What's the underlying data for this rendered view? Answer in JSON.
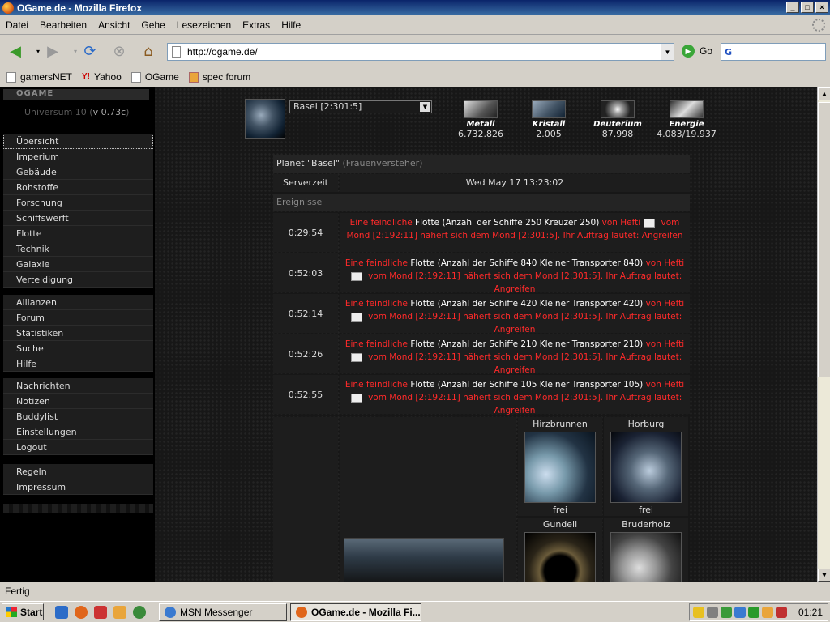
{
  "window": {
    "title": "OGame.de - Mozilla Firefox"
  },
  "menubar": {
    "items": [
      "Datei",
      "Bearbeiten",
      "Ansicht",
      "Gehe",
      "Lesezeichen",
      "Extras",
      "Hilfe"
    ]
  },
  "navbar": {
    "url": "http://ogame.de/",
    "go_label": "Go",
    "search_brand": "G"
  },
  "bookmarks": [
    {
      "label": "gamersNET",
      "icon": "page-icon"
    },
    {
      "label": "Yahoo",
      "icon": "yahoo-icon"
    },
    {
      "label": "OGame",
      "icon": "page-icon"
    },
    {
      "label": "spec forum",
      "icon": "bookmark-folder-icon"
    }
  ],
  "game": {
    "logo": "OGAME",
    "universe": "Universum 10",
    "version": "v 0.73c",
    "menu_groups": [
      [
        "Übersicht",
        "Imperium",
        "Gebäude",
        "Rohstoffe",
        "Forschung",
        "Schiffswerft",
        "Flotte",
        "Technik",
        "Galaxie",
        "Verteidigung"
      ],
      [
        "Allianzen",
        "Forum",
        "Statistiken",
        "Suche",
        "Hilfe"
      ],
      [
        "Nachrichten",
        "Notizen",
        "Buddylist",
        "Einstellungen",
        "Logout"
      ],
      [
        "Regeln",
        "Impressum"
      ]
    ],
    "planet_select": "Basel [2:301:5]",
    "resources": [
      {
        "name": "Metall",
        "value": "6.732.826"
      },
      {
        "name": "Kristall",
        "value": "2.005"
      },
      {
        "name": "Deuterium",
        "value": "87.998"
      },
      {
        "name": "Energie",
        "value": "4.083/19.937"
      }
    ],
    "planet_title": "Planet \"Basel\"",
    "planet_owner": "(Frauenversteher)",
    "server_label": "Serverzeit",
    "server_time": "Wed May 17 13:23:02",
    "events_label": "Ereignisse",
    "events": [
      {
        "time": "0:29:54",
        "prefix": "Eine feindliche",
        "fleet": "Flotte",
        "ships": "(Anzahl der Schiffe 250 Kreuzer 250)",
        "from": "von Hefti",
        "rest": "vom Mond [2:192:11] nähert sich dem Mond [2:301:5]. Ihr Auftrag lautet: Angreifen"
      },
      {
        "time": "0:52:03",
        "prefix": "Eine feindliche",
        "fleet": "Flotte",
        "ships": "(Anzahl der Schiffe 840 Kleiner Transporter 840)",
        "from": "von Hefti",
        "rest": "vom Mond [2:192:11] nähert sich dem Mond [2:301:5]. Ihr Auftrag lautet: Angreifen"
      },
      {
        "time": "0:52:14",
        "prefix": "Eine feindliche",
        "fleet": "Flotte",
        "ships": "(Anzahl der Schiffe 420 Kleiner Transporter 420)",
        "from": "von Hefti",
        "rest": "vom Mond [2:192:11] nähert sich dem Mond [2:301:5]. Ihr Auftrag lautet: Angreifen"
      },
      {
        "time": "0:52:26",
        "prefix": "Eine feindliche",
        "fleet": "Flotte",
        "ships": "(Anzahl der Schiffe 210 Kleiner Transporter 210)",
        "from": "von Hefti",
        "rest": "vom Mond [2:192:11] nähert sich dem Mond [2:301:5]. Ihr Auftrag lautet: Angreifen"
      },
      {
        "time": "0:52:55",
        "prefix": "Eine feindliche",
        "fleet": "Flotte",
        "ships": "(Anzahl der Schiffe 105 Kleiner Transporter 105)",
        "from": "von Hefti",
        "rest": "vom Mond [2:192:11] nähert sich dem Mond [2:301:5]. Ihr Auftrag lautet: Angreifen"
      }
    ],
    "moons": [
      {
        "name": "Hirzbrunnen",
        "status": "frei"
      },
      {
        "name": "Horburg",
        "status": "frei"
      },
      {
        "name": "Gundeli",
        "status": ""
      },
      {
        "name": "Bruderholz",
        "status": ""
      }
    ]
  },
  "statusbar": {
    "text": "Fertig"
  },
  "taskbar": {
    "start_label": "Start",
    "tasks": [
      {
        "label": "MSN Messenger",
        "active": false
      },
      {
        "label": "OGame.de - Mozilla Fi...",
        "active": true
      }
    ],
    "clock": "01:21"
  },
  "colors": {
    "enemy_text": "#ff2a2a",
    "background": "#171717"
  }
}
